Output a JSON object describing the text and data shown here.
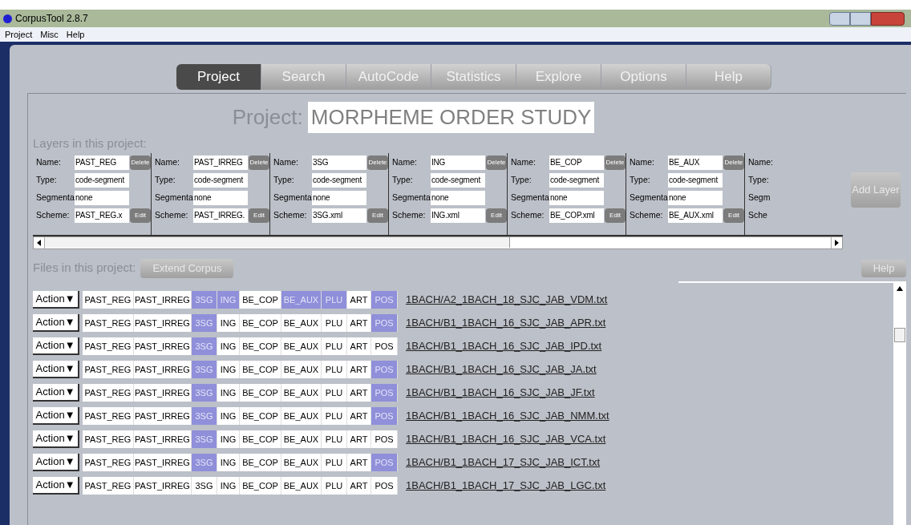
{
  "window": {
    "title": "CorpusTool 2.8.7"
  },
  "menu": [
    "Project",
    "Misc",
    "Help"
  ],
  "tabs": [
    {
      "label": "Project",
      "selected": true
    },
    {
      "label": "Search",
      "selected": false
    },
    {
      "label": "AutoCode",
      "selected": false
    },
    {
      "label": "Statistics",
      "selected": false
    },
    {
      "label": "Explore",
      "selected": false
    },
    {
      "label": "Options",
      "selected": false
    },
    {
      "label": "Help",
      "selected": false
    }
  ],
  "project": {
    "label": "Project:",
    "name": "MORPHEME ORDER STUDY"
  },
  "layers_heading": "Layers in this project:",
  "layers": [
    {
      "name_label": "Name:",
      "name": "PAST_REG",
      "delete": "Delete",
      "type_label": "Type:",
      "type": "code-segment",
      "seg_label": "Segmenta",
      "seg": "none",
      "scheme_label": "Scheme:",
      "scheme": "PAST_REG.x",
      "edit": "Edit"
    },
    {
      "name_label": "Name:",
      "name": "PAST_IRREG",
      "delete": "Delete",
      "type_label": "Type:",
      "type": "code-segment",
      "seg_label": "Segmenta",
      "seg": "none",
      "scheme_label": "Scheme:",
      "scheme": "PAST_IRREG.",
      "edit": "Edit"
    },
    {
      "name_label": "Name:",
      "name": "3SG",
      "delete": "Delete",
      "type_label": "Type:",
      "type": "code-segment",
      "seg_label": "Segmenta",
      "seg": "none",
      "scheme_label": "Scheme:",
      "scheme": "3SG.xml",
      "edit": "Edit"
    },
    {
      "name_label": "Name:",
      "name": "ING",
      "delete": "Delete",
      "type_label": "Type:",
      "type": "code-segment",
      "seg_label": "Segmenta",
      "seg": "none",
      "scheme_label": "Scheme:",
      "scheme": "ING.xml",
      "edit": "Edit"
    },
    {
      "name_label": "Name:",
      "name": "BE_COP",
      "delete": "Delete",
      "type_label": "Type:",
      "type": "code-segment",
      "seg_label": "Segmenta",
      "seg": "none",
      "scheme_label": "Scheme:",
      "scheme": "BE_COP.xml",
      "edit": "Edit"
    },
    {
      "name_label": "Name:",
      "name": "BE_AUX",
      "delete": "Delete",
      "type_label": "Type:",
      "type": "code-segment",
      "seg_label": "Segmenta",
      "seg": "none",
      "scheme_label": "Scheme:",
      "scheme": "BE_AUX.xml",
      "edit": "Edit"
    },
    {
      "name_label": "Name:",
      "type_label": "Type:",
      "seg_label": "Segm",
      "scheme_label": "Sche"
    }
  ],
  "add_layer": "Add Layer",
  "files_heading": "Files in this project:",
  "extend_corpus": "Extend Corpus",
  "help_button": "Help",
  "files": [
    {
      "action": "Action▼",
      "codes": [
        {
          "label": "PAST_REG",
          "on": false
        },
        {
          "label": "PAST_IRREG",
          "on": false
        },
        {
          "label": "3SG",
          "on": true
        },
        {
          "label": "ING",
          "on": true
        },
        {
          "label": "BE_COP",
          "on": false
        },
        {
          "label": "BE_AUX",
          "on": true
        },
        {
          "label": "PLU",
          "on": true
        },
        {
          "label": "ART",
          "on": false
        },
        {
          "label": "POS",
          "on": true
        }
      ],
      "file": "1BACH/A2_1BACH_18_SJC_JAB_VDM.txt"
    },
    {
      "action": "Action▼",
      "codes": [
        {
          "label": "PAST_REG",
          "on": false
        },
        {
          "label": "PAST_IRREG",
          "on": false
        },
        {
          "label": "3SG",
          "on": true
        },
        {
          "label": "ING",
          "on": false
        },
        {
          "label": "BE_COP",
          "on": false
        },
        {
          "label": "BE_AUX",
          "on": false
        },
        {
          "label": "PLU",
          "on": false
        },
        {
          "label": "ART",
          "on": false
        },
        {
          "label": "POS",
          "on": true
        }
      ],
      "file": "1BACH/B1_1BACH_16_SJC_JAB_APR.txt"
    },
    {
      "action": "Action▼",
      "codes": [
        {
          "label": "PAST_REG",
          "on": false
        },
        {
          "label": "PAST_IRREG",
          "on": false
        },
        {
          "label": "3SG",
          "on": true
        },
        {
          "label": "ING",
          "on": false
        },
        {
          "label": "BE_COP",
          "on": false
        },
        {
          "label": "BE_AUX",
          "on": false
        },
        {
          "label": "PLU",
          "on": false
        },
        {
          "label": "ART",
          "on": false
        },
        {
          "label": "POS",
          "on": false
        }
      ],
      "file": "1BACH/B1_1BACH_16_SJC_JAB_IPD.txt"
    },
    {
      "action": "Action▼",
      "codes": [
        {
          "label": "PAST_REG",
          "on": false
        },
        {
          "label": "PAST_IRREG",
          "on": false
        },
        {
          "label": "3SG",
          "on": true
        },
        {
          "label": "ING",
          "on": false
        },
        {
          "label": "BE_COP",
          "on": false
        },
        {
          "label": "BE_AUX",
          "on": false
        },
        {
          "label": "PLU",
          "on": false
        },
        {
          "label": "ART",
          "on": false
        },
        {
          "label": "POS",
          "on": true
        }
      ],
      "file": "1BACH/B1_1BACH_16_SJC_JAB_JA.txt"
    },
    {
      "action": "Action▼",
      "codes": [
        {
          "label": "PAST_REG",
          "on": false
        },
        {
          "label": "PAST_IRREG",
          "on": false
        },
        {
          "label": "3SG",
          "on": true
        },
        {
          "label": "ING",
          "on": false
        },
        {
          "label": "BE_COP",
          "on": false
        },
        {
          "label": "BE_AUX",
          "on": false
        },
        {
          "label": "PLU",
          "on": false
        },
        {
          "label": "ART",
          "on": false
        },
        {
          "label": "POS",
          "on": true
        }
      ],
      "file": "1BACH/B1_1BACH_16_SJC_JAB_JF.txt"
    },
    {
      "action": "Action▼",
      "codes": [
        {
          "label": "PAST_REG",
          "on": false
        },
        {
          "label": "PAST_IRREG",
          "on": false
        },
        {
          "label": "3SG",
          "on": true
        },
        {
          "label": "ING",
          "on": false
        },
        {
          "label": "BE_COP",
          "on": false
        },
        {
          "label": "BE_AUX",
          "on": false
        },
        {
          "label": "PLU",
          "on": false
        },
        {
          "label": "ART",
          "on": false
        },
        {
          "label": "POS",
          "on": true
        }
      ],
      "file": "1BACH/B1_1BACH_16_SJC_JAB_NMM.txt"
    },
    {
      "action": "Action▼",
      "codes": [
        {
          "label": "PAST_REG",
          "on": false
        },
        {
          "label": "PAST_IRREG",
          "on": false
        },
        {
          "label": "3SG",
          "on": true
        },
        {
          "label": "ING",
          "on": false
        },
        {
          "label": "BE_COP",
          "on": false
        },
        {
          "label": "BE_AUX",
          "on": false
        },
        {
          "label": "PLU",
          "on": false
        },
        {
          "label": "ART",
          "on": false
        },
        {
          "label": "POS",
          "on": false
        }
      ],
      "file": "1BACH/B1_1BACH_16_SJC_JAB_VCA.txt"
    },
    {
      "action": "Action▼",
      "codes": [
        {
          "label": "PAST_REG",
          "on": false
        },
        {
          "label": "PAST_IRREG",
          "on": false
        },
        {
          "label": "3SG",
          "on": true
        },
        {
          "label": "ING",
          "on": false
        },
        {
          "label": "BE_COP",
          "on": false
        },
        {
          "label": "BE_AUX",
          "on": false
        },
        {
          "label": "PLU",
          "on": false
        },
        {
          "label": "ART",
          "on": false
        },
        {
          "label": "POS",
          "on": true
        }
      ],
      "file": "1BACH/B1_1BACH_17_SJC_JAB_ICT.txt"
    },
    {
      "action": "Action▼",
      "codes": [
        {
          "label": "PAST_REG",
          "on": false
        },
        {
          "label": "PAST_IRREG",
          "on": false
        },
        {
          "label": "3SG",
          "on": false
        },
        {
          "label": "ING",
          "on": false
        },
        {
          "label": "BE_COP",
          "on": false
        },
        {
          "label": "BE_AUX",
          "on": false
        },
        {
          "label": "PLU",
          "on": false
        },
        {
          "label": "ART",
          "on": false
        },
        {
          "label": "POS",
          "on": false
        }
      ],
      "file": "1BACH/B1_1BACH_17_SJC_JAB_LGC.txt"
    }
  ]
}
